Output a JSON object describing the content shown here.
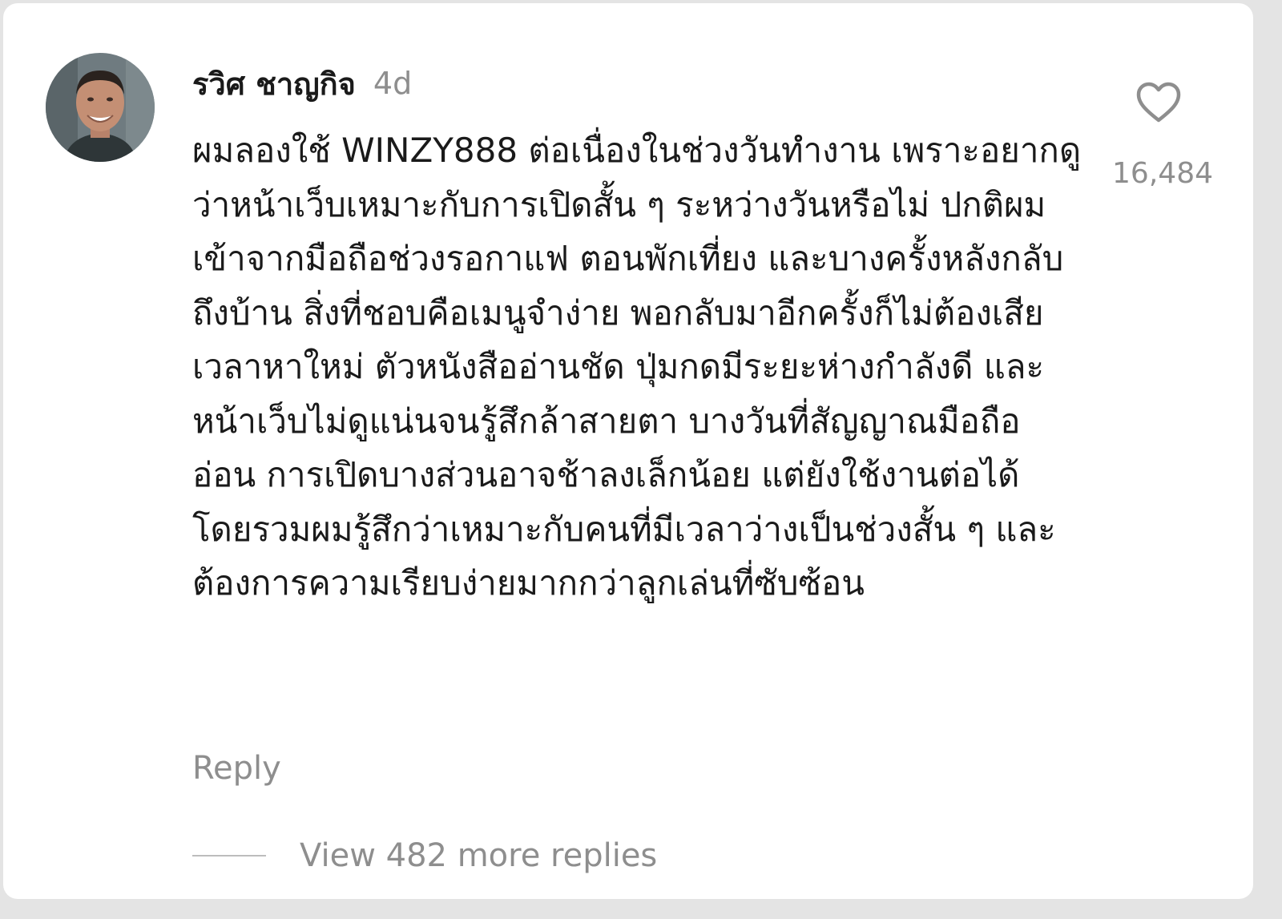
{
  "comment": {
    "author": "รวิศ ชาญกิจ",
    "time_ago": "4d",
    "text": "ผมลองใช้ WINZY888 ต่อเนื่องในช่วงวันทำงาน เพราะอยากดูว่าหน้าเว็บเหมาะกับการเปิดสั้น ๆ ระหว่างวันหรือไม่ ปกติผมเข้าจากมือถือช่วงรอกาแฟ ตอนพักเที่ยง และบางครั้งหลังกลับถึงบ้าน สิ่งที่ชอบคือเมนูจำง่าย พอกลับมาอีกครั้งก็ไม่ต้องเสียเวลาหาใหม่ ตัวหนังสืออ่านชัด ปุ่มกดมีระยะห่างกำลังดี และหน้าเว็บไม่ดูแน่นจนรู้สึกล้าสายตา บางวันที่สัญญาณมือถืออ่อน การเปิดบางส่วนอาจช้าลงเล็กน้อย แต่ยังใช้งานต่อได้ โดยรวมผมรู้สึกว่าเหมาะกับคนที่มีเวลาว่างเป็นช่วงสั้น ๆ และต้องการความเรียบง่ายมากกว่าลูกเล่นที่ซับซ้อน",
    "like_count": "16,484",
    "reply_label": "Reply",
    "view_replies_label": "View 482 more replies"
  },
  "icons": {
    "avatar": "avatar-photo",
    "like": "heart-outline-icon"
  },
  "colors": {
    "primary_text": "#1a1a1a",
    "secondary_text": "#8e8e8e",
    "background": "#ffffff"
  }
}
